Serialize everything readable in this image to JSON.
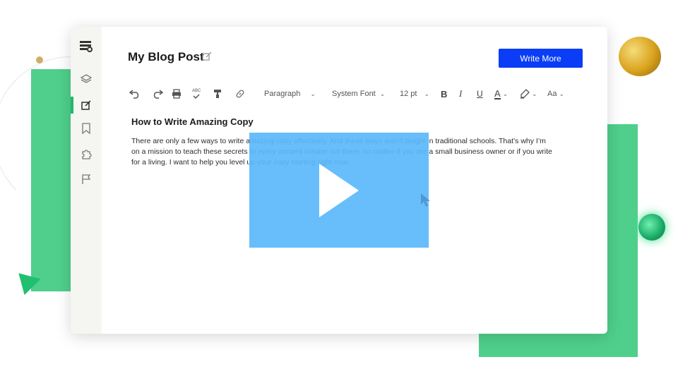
{
  "post": {
    "title": "My Blog Post"
  },
  "actions": {
    "write_more": "Write More"
  },
  "toolbar": {
    "paragraph": "Paragraph",
    "font": "System Font",
    "size": "12 pt",
    "bold": "B",
    "italic": "I",
    "underline": "U",
    "text_color": "A",
    "text_size": "Aa",
    "spellcheck": "ABC"
  },
  "document": {
    "heading": "How to Write Amazing Copy",
    "body": "There are only a few ways to write amazing copy effectively. And these ways aren’t taught in traditional schools. That’s why I’m on a mission to teach these secrets to every content creator out there, no matter if you are a small business owner or if you write for a living. I want to help you level up your copy starting right now."
  },
  "sidebar": {
    "icons": [
      "logo-icon",
      "layers-icon",
      "edit-icon",
      "bookmark-icon",
      "puzzle-icon",
      "flag-icon"
    ],
    "active": "edit-icon"
  },
  "colors": {
    "accent": "#0a3df5",
    "green": "#4fcf8b",
    "overlay": "#5ab9fa"
  }
}
